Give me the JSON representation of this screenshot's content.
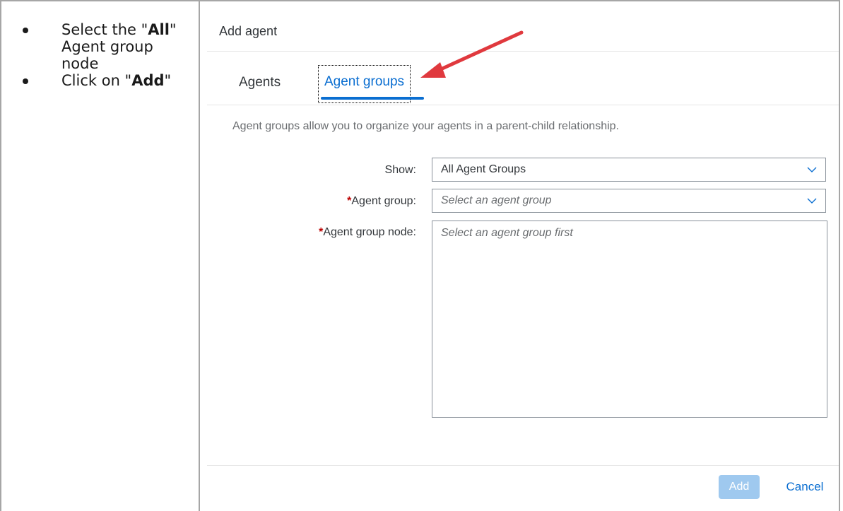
{
  "instructions": {
    "items": [
      {
        "pre": "Select the \"",
        "bold": "All",
        "post": "\" Agent group node"
      },
      {
        "pre": "Click on \"",
        "bold": "Add",
        "post": "\""
      }
    ]
  },
  "dialog": {
    "title": "Add agent",
    "tabs": [
      "Agents",
      "Agent groups"
    ],
    "active_tab": "Agent groups",
    "description": "Agent groups allow you to organize your agents in a parent-child relationship.",
    "form": {
      "show_label": "Show:",
      "show_value": "All Agent Groups",
      "agent_group_required": "*",
      "agent_group_label": "Agent group:",
      "agent_group_placeholder": "Select an agent group",
      "agent_group_node_required": "*",
      "agent_group_node_label": "Agent group node:",
      "agent_group_node_placeholder": "Select an agent group first"
    },
    "buttons": {
      "add": "Add",
      "cancel": "Cancel"
    }
  },
  "colors": {
    "accent": "#0a6ed1",
    "required": "#bb0000",
    "annotation_arrow": "#e0393e"
  },
  "icons": [
    "chevron-down-icon",
    "annotation-arrow-icon"
  ]
}
